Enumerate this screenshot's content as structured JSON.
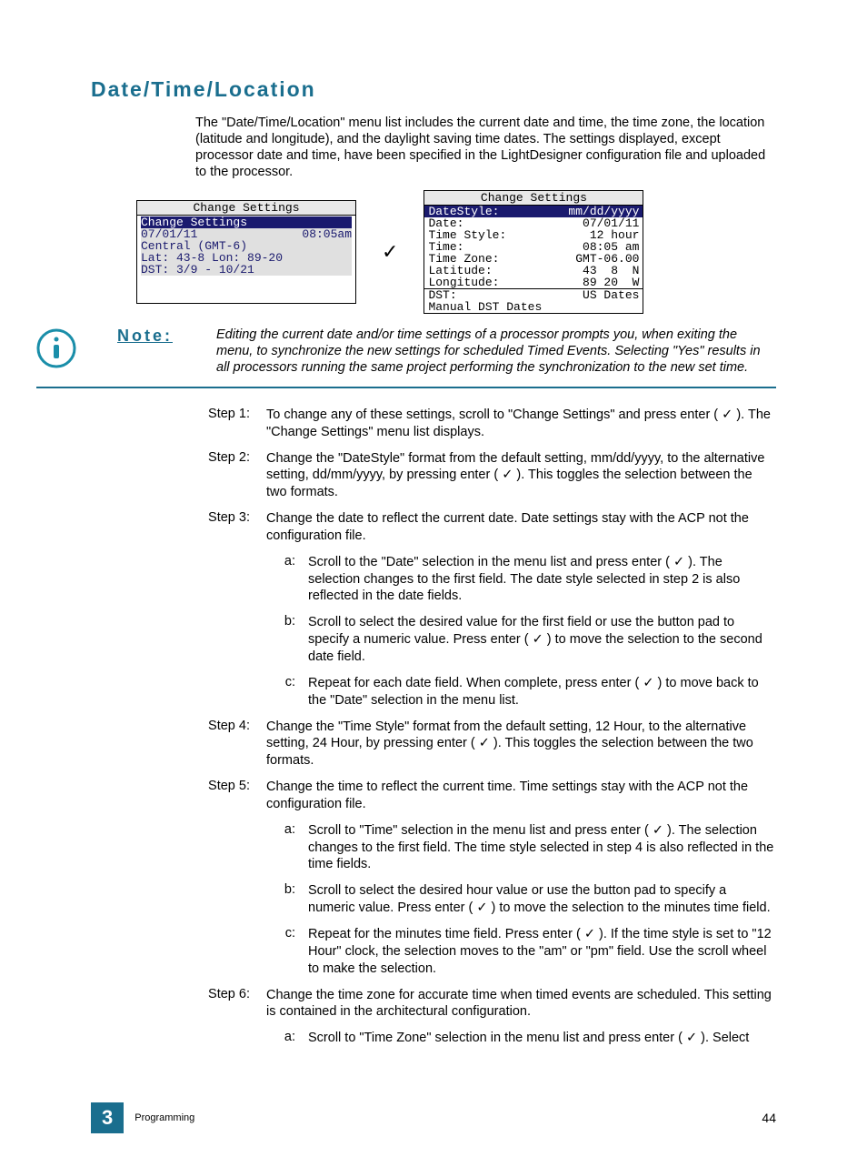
{
  "title": "Date/Time/Location",
  "intro": "The \"Date/Time/Location\" menu list includes the current date and time, the time zone, the location (latitude and longitude), and the daylight saving time dates. The settings displayed, except processor date and time, have been specified in the LightDesigner configuration file and uploaded to the processor.",
  "screenA": {
    "title": "Change Settings",
    "r1": "Change Settings",
    "r2l": "07/01/11",
    "r2r": "08:05am",
    "r3": "Central (GMT-6)",
    "r4": "Lat: 43-8 Lon: 89-20",
    "r5": "DST: 3/9 - 10/21"
  },
  "arrow": "✓",
  "screenB": {
    "title": "Change Settings",
    "rows": [
      {
        "l": "DateStyle:",
        "r": "mm/dd/yyyy"
      },
      {
        "l": "Date:",
        "r": "07/01/11"
      },
      {
        "l": "Time Style:",
        "r": "12 hour"
      },
      {
        "l": "Time:",
        "r": "08:05 am"
      },
      {
        "l": "Time Zone:",
        "r": "GMT-06.00"
      },
      {
        "l": "Latitude:",
        "r": "43  8  N"
      },
      {
        "l": "Longitude:",
        "r": "89 20  W"
      },
      {
        "l": "DST:",
        "r": "US Dates"
      },
      {
        "l": "Manual DST Dates",
        "r": ""
      }
    ]
  },
  "note": {
    "label": "Note:",
    "text": "Editing the current date and/or time settings of a processor prompts you, when exiting the menu, to synchronize the new settings for scheduled Timed Events. Selecting \"Yes\" results in all processors running the same project performing the synchronization to the new set time."
  },
  "steps": {
    "s1": {
      "label": "Step 1:",
      "a": "To change any of these settings, scroll to \"Change Settings\" and press enter ( ",
      "b": " ). The \"Change Settings\" menu list displays."
    },
    "s2": {
      "label": "Step 2:",
      "a": "Change the \"DateStyle\" format from the default setting, mm/dd/yyyy, to the alternative setting, dd/mm/yyyy, by pressing enter ( ",
      "b": " ). This toggles the selection between the two formats."
    },
    "s3": {
      "label": "Step 3:",
      "text": "Change the date to reflect the current date. Date settings stay with the ACP not the configuration file."
    },
    "s3a": {
      "label": "a:",
      "a": "Scroll to the \"Date\" selection in the menu list and press enter ( ",
      "b": " ). The selection changes to the first field. The date style selected in step 2 is also reflected in the date fields."
    },
    "s3b": {
      "label": "b:",
      "a": "Scroll to select the desired value for the first field or use the button pad to specify a numeric value. Press enter ( ",
      "b": " ) to move the selection to the second date field."
    },
    "s3c": {
      "label": "c:",
      "a": "Repeat for each date field. When complete, press enter ( ",
      "b": " ) to move back to the \"Date\" selection in the menu list."
    },
    "s4": {
      "label": "Step 4:",
      "a": "Change the \"Time Style\" format from the default setting, 12 Hour, to the alternative setting, 24 Hour, by pressing enter ( ",
      "b": " ). This toggles the selection between the two formats."
    },
    "s5": {
      "label": "Step 5:",
      "text": "Change the time to reflect the current time. Time settings stay with the ACP not the configuration file."
    },
    "s5a": {
      "label": "a:",
      "a": "Scroll to \"Time\" selection in the menu list and press enter ( ",
      "b": " ). The selection changes to the first field. The time style selected in step 4 is also reflected in the time fields."
    },
    "s5b": {
      "label": "b:",
      "a": "Scroll to select the desired hour value or use the button pad to specify a numeric value. Press enter ( ",
      "b": " ) to move the selection to the minutes time field."
    },
    "s5c": {
      "label": "c:",
      "a": "Repeat for the minutes time field. Press enter ( ",
      "b": " ). If the time style is set to \"12 Hour\" clock, the selection moves to the \"am\" or \"pm\" field. Use the scroll wheel to make the selection."
    },
    "s6": {
      "label": "Step 6:",
      "text": "Change the time zone for accurate time when timed events are scheduled. This setting is contained in the architectural configuration."
    },
    "s6a": {
      "label": "a:",
      "a": "Scroll to \"Time Zone\" selection in the menu list and press enter ( ",
      "b": " ). Select"
    }
  },
  "check": "✓",
  "footer": {
    "chap": "3",
    "section": "Programming",
    "page": "44"
  }
}
